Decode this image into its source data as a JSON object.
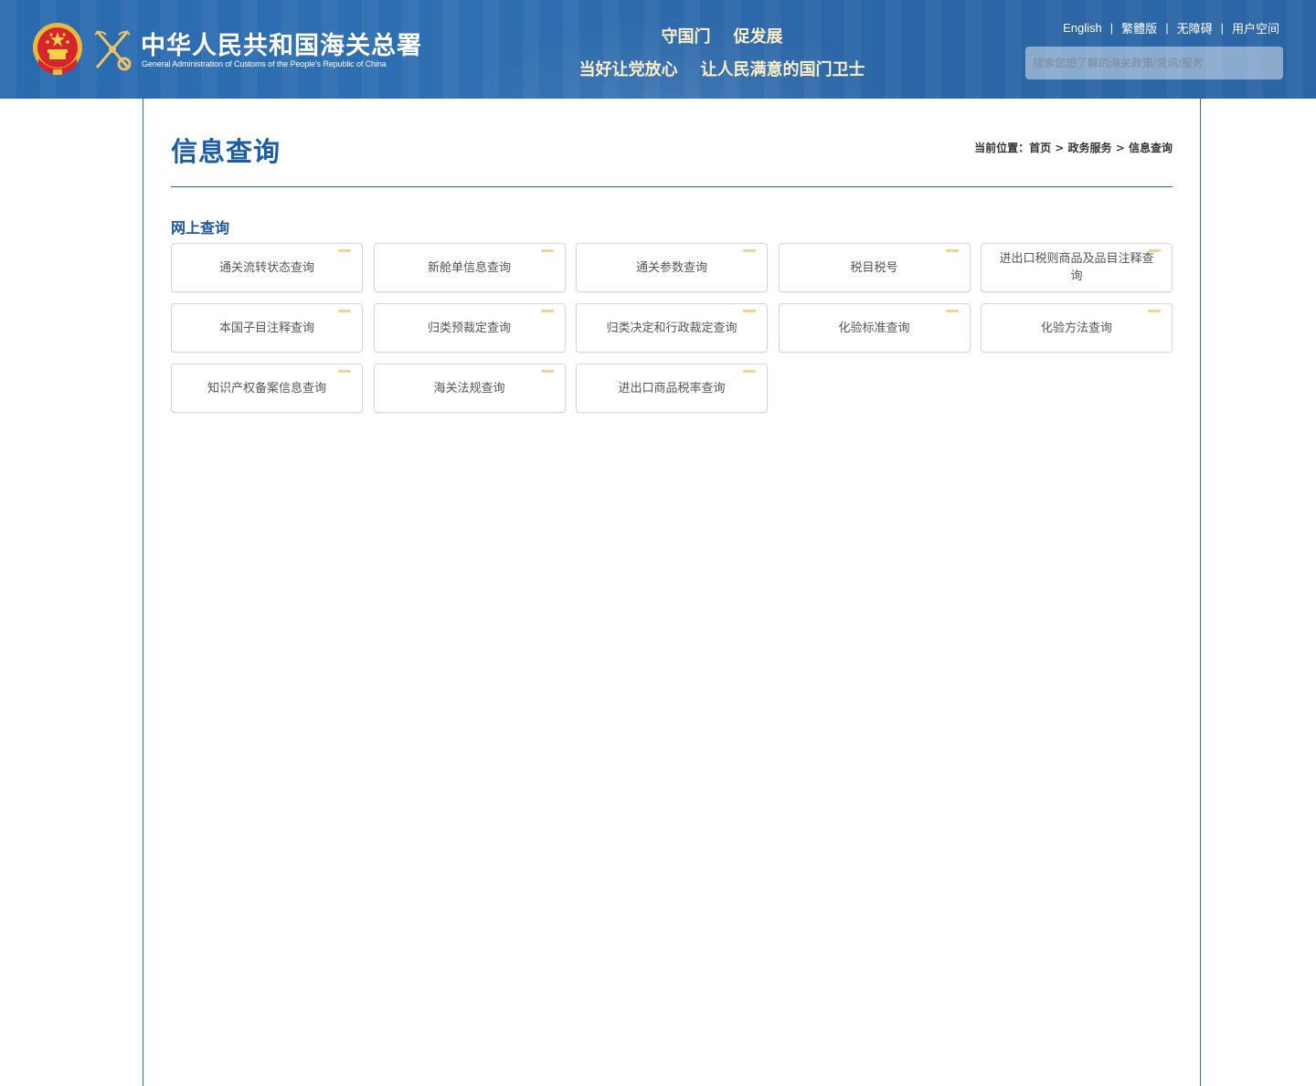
{
  "header": {
    "logo_cn": "中华人民共和国海关总署",
    "logo_en": "General Administration of Customs of the People's Republic of China",
    "slogan_line1": "守国门    促发展",
    "slogan_line2": "当好让党放心    让人民满意的国门卫士",
    "links": [
      "English",
      "繁體版",
      "无障碍",
      "用户空间"
    ],
    "link_separator": "|",
    "search_placeholder": "搜索您想了解的海关政策/资讯/服务",
    "icons": {
      "emblem": "national-emblem-icon",
      "badge": "customs-badge-icon"
    },
    "colors": {
      "bar": "#2c6aad",
      "slogan": "#fbefc8"
    }
  },
  "page": {
    "title": "信息查询",
    "breadcrumb": {
      "prefix": "当前位置：",
      "items": [
        "首页",
        "政务服务",
        "信息查询"
      ],
      "separator": " > "
    },
    "section_title": "网上查询",
    "accent_color": "#1c5ea3",
    "card_accent_color": "#f2d394"
  },
  "cards": [
    "通关流转状态查询",
    "新舱单信息查询",
    "通关参数查询",
    "税目税号",
    "进出口税则商品及品目注释查询",
    "本国子目注释查询",
    "归类预裁定查询",
    "归类决定和行政裁定查询",
    "化验标准查询",
    "化验方法查询",
    "知识产权备案信息查询",
    "海关法规查询",
    "进出口商品税率查询"
  ]
}
